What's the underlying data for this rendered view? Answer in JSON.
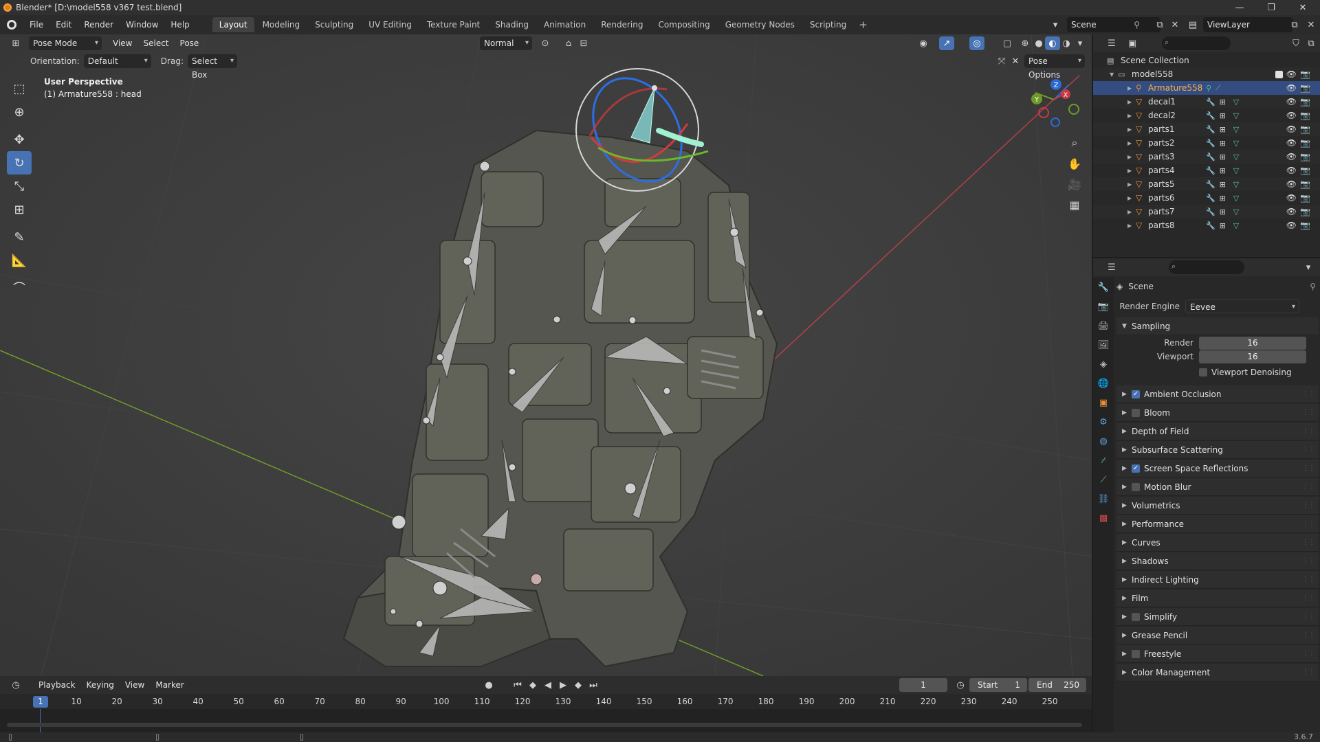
{
  "window": {
    "title": "Blender* [D:\\model558 v367 test.blend]",
    "controls": [
      "—",
      "❐",
      "✕"
    ]
  },
  "menu": [
    "File",
    "Edit",
    "Render",
    "Window",
    "Help"
  ],
  "workspaces": [
    "Layout",
    "Modeling",
    "Sculpting",
    "UV Editing",
    "Texture Paint",
    "Shading",
    "Animation",
    "Rendering",
    "Compositing",
    "Geometry Nodes",
    "Scripting"
  ],
  "active_workspace": "Layout",
  "scene_name": "Scene",
  "view_layer": "ViewLayer",
  "viewport": {
    "mode": "Pose Mode",
    "header_menus": [
      "View",
      "Select",
      "Pose"
    ],
    "transform_orientation_pivot": "Normal",
    "orientation_label": "Orientation:",
    "orientation_value": "Default",
    "drag_label": "Drag:",
    "drag_value": "Select Box",
    "pose_options": "Pose Options",
    "info_line1": "User Perspective",
    "info_line2": "(1) Armature558 : head",
    "gizmo_axes": {
      "x": "X",
      "y": "Y",
      "z": "Z"
    }
  },
  "outliner": {
    "root": "Scene Collection",
    "collection": "model558",
    "items": [
      {
        "name": "Armature558",
        "type": "armature",
        "selected": true
      },
      {
        "name": "decal1",
        "type": "mesh"
      },
      {
        "name": "decal2",
        "type": "mesh"
      },
      {
        "name": "parts1",
        "type": "mesh"
      },
      {
        "name": "parts2",
        "type": "mesh"
      },
      {
        "name": "parts3",
        "type": "mesh"
      },
      {
        "name": "parts4",
        "type": "mesh"
      },
      {
        "name": "parts5",
        "type": "mesh"
      },
      {
        "name": "parts6",
        "type": "mesh"
      },
      {
        "name": "parts7",
        "type": "mesh"
      },
      {
        "name": "parts8",
        "type": "mesh"
      }
    ]
  },
  "properties": {
    "context": "Scene",
    "render_engine_label": "Render Engine",
    "render_engine": "Eevee",
    "sampling": {
      "title": "Sampling",
      "render_label": "Render",
      "render_value": "16",
      "viewport_label": "Viewport",
      "viewport_value": "16",
      "denoise_label": "Viewport Denoising",
      "denoise_checked": false
    },
    "panels": [
      {
        "label": "Ambient Occlusion",
        "checkbox": true,
        "checked": true
      },
      {
        "label": "Bloom",
        "checkbox": true,
        "checked": false
      },
      {
        "label": "Depth of Field",
        "checkbox": false
      },
      {
        "label": "Subsurface Scattering",
        "checkbox": false
      },
      {
        "label": "Screen Space Reflections",
        "checkbox": true,
        "checked": true
      },
      {
        "label": "Motion Blur",
        "checkbox": true,
        "checked": false
      },
      {
        "label": "Volumetrics",
        "checkbox": false
      },
      {
        "label": "Performance",
        "checkbox": false
      },
      {
        "label": "Curves",
        "checkbox": false
      },
      {
        "label": "Shadows",
        "checkbox": false
      },
      {
        "label": "Indirect Lighting",
        "checkbox": false
      },
      {
        "label": "Film",
        "checkbox": false
      },
      {
        "label": "Simplify",
        "checkbox": true,
        "checked": false
      },
      {
        "label": "Grease Pencil",
        "checkbox": false
      },
      {
        "label": "Freestyle",
        "checkbox": true,
        "checked": false
      },
      {
        "label": "Color Management",
        "checkbox": false
      }
    ]
  },
  "timeline": {
    "menus": [
      "Playback",
      "Keying",
      "View",
      "Marker"
    ],
    "current_frame": "1",
    "start_label": "Start",
    "start": "1",
    "end_label": "End",
    "end": "250",
    "ruler": [
      "10",
      "20",
      "30",
      "40",
      "50",
      "60",
      "70",
      "80",
      "90",
      "100",
      "110",
      "120",
      "130",
      "140",
      "150",
      "160",
      "170",
      "180",
      "190",
      "200",
      "210",
      "220",
      "230",
      "240",
      "250"
    ],
    "cursor_label": "1"
  },
  "status": {
    "version": "3.6.7"
  },
  "colors": {
    "accent": "#4772b3",
    "selection": "#334d80",
    "object_orange": "#e8913a"
  }
}
